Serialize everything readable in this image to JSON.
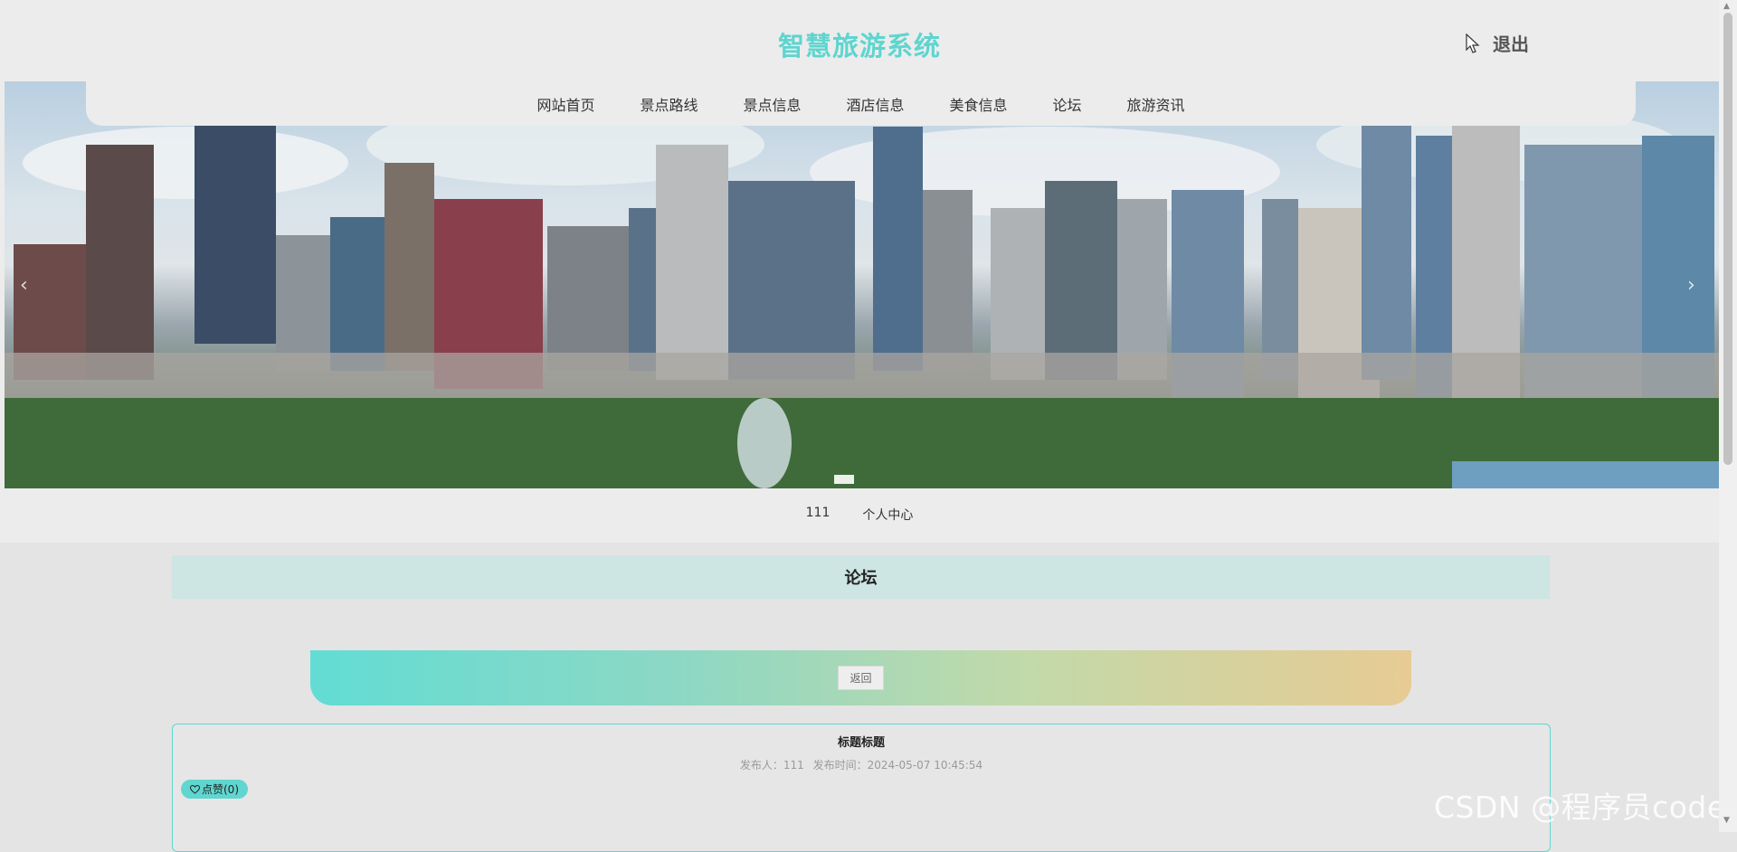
{
  "header": {
    "title": "智慧旅游系统",
    "logout": "退出"
  },
  "nav": {
    "items": [
      "网站首页",
      "景点路线",
      "景点信息",
      "酒店信息",
      "美食信息",
      "论坛",
      "旅游资讯"
    ]
  },
  "carousel": {
    "prev": "‹",
    "next": "›"
  },
  "user_links": {
    "username": "111",
    "personal_center": "个人中心"
  },
  "section": {
    "title": "论坛"
  },
  "actions": {
    "back": "返回"
  },
  "post": {
    "title": "标题标题",
    "author_label": "发布人：111",
    "time_label": "发布时间：2024-05-07 10:45:54",
    "like_label": "点赞(0)"
  },
  "watermark": "CSDN @程序员code",
  "colors": {
    "accent": "#5ed5cf",
    "section_bg": "#cde5e3"
  }
}
